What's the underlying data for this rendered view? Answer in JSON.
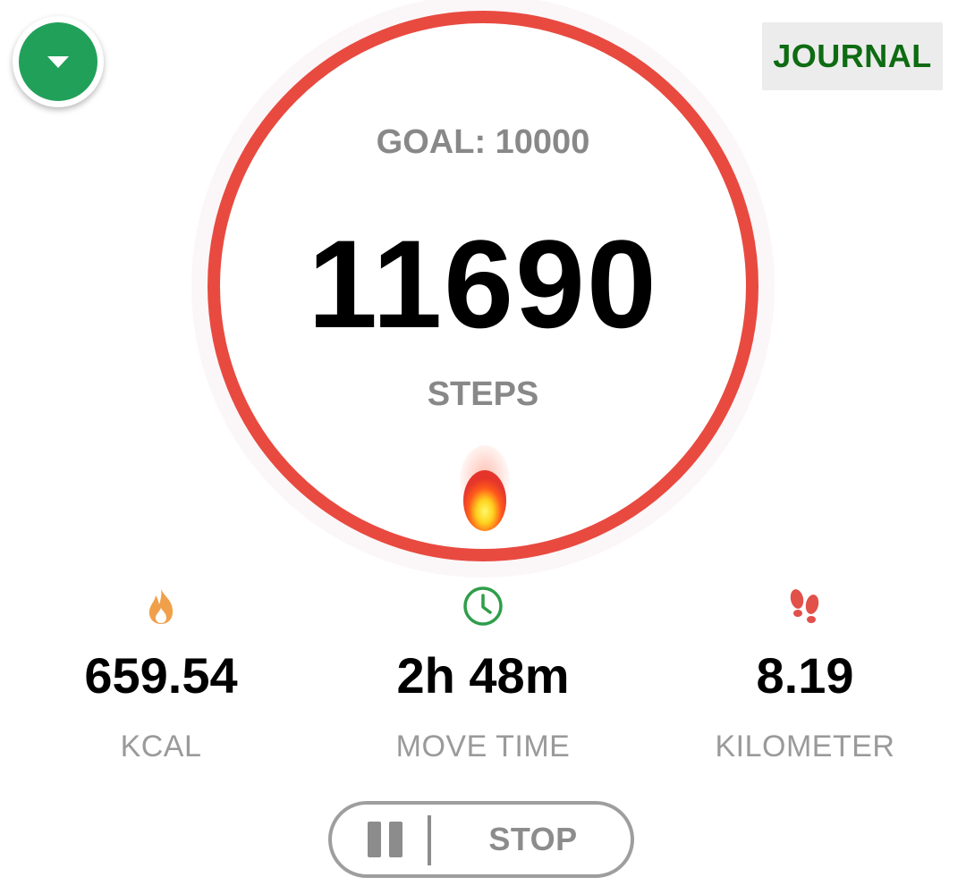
{
  "header": {
    "dropdown_icon": "chevron-down-icon",
    "journal_label": "JOURNAL"
  },
  "progress": {
    "goal_label": "GOAL: 10000",
    "steps_value": "11690",
    "steps_label": "STEPS",
    "ring_fill_fraction": 1.0,
    "ring_color": "#e84a40",
    "indicator_icon": "fireball-icon"
  },
  "stats": {
    "kcal": {
      "icon": "flame-icon",
      "value": "659.54",
      "label": "KCAL",
      "color": "#f0a04b"
    },
    "move_time": {
      "icon": "clock-icon",
      "value": "2h 48m",
      "label": "MOVE TIME",
      "color": "#2e9e4a"
    },
    "distance": {
      "icon": "footprints-icon",
      "value": "8.19",
      "label": "KILOMETER",
      "color": "#e2504a"
    }
  },
  "controls": {
    "pause_icon": "pause-icon",
    "stop_label": "STOP"
  }
}
